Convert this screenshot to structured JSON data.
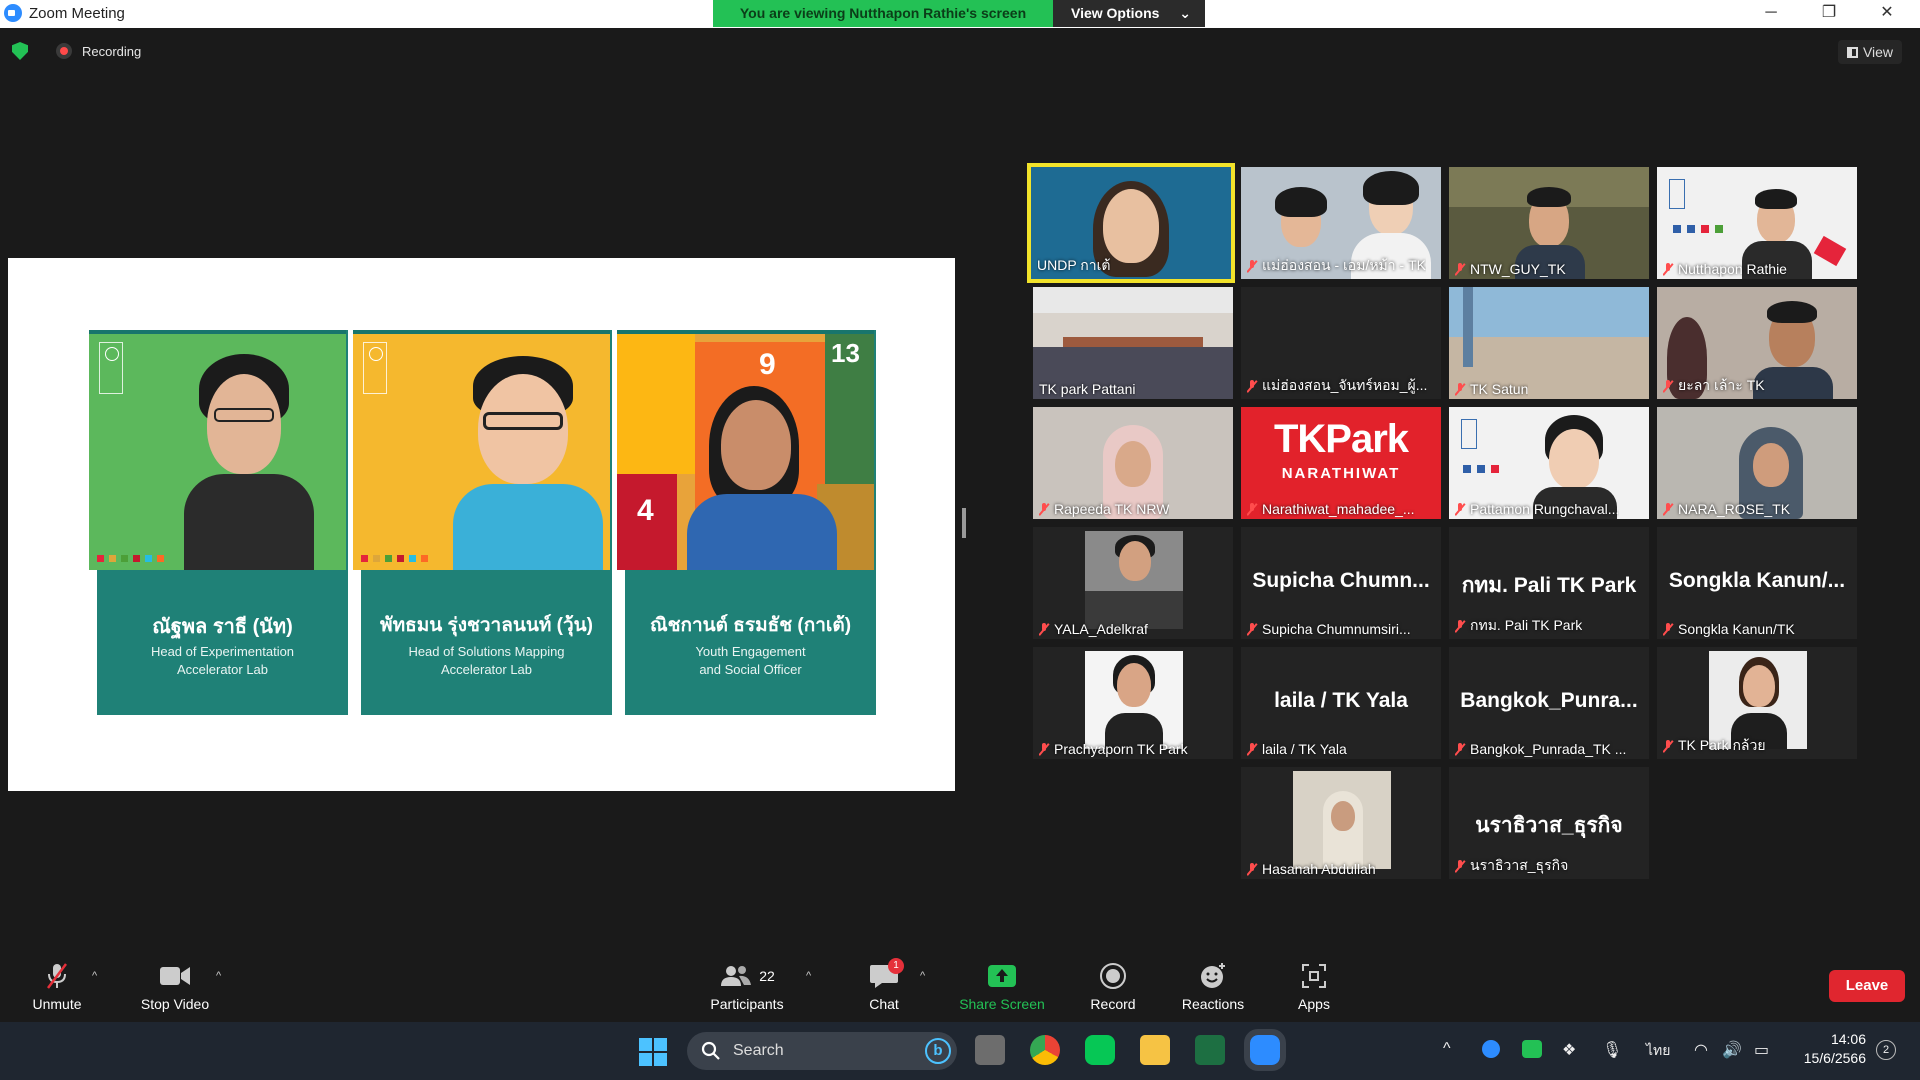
{
  "window": {
    "title": "Zoom Meeting"
  },
  "banner": {
    "message": "You are viewing Nutthapon Rathie's screen",
    "view_options": "View Options"
  },
  "status": {
    "recording": "Recording"
  },
  "view_button": "View",
  "slide": {
    "people": [
      {
        "name": "ณัฐพล ราธี (นัท)",
        "role_line1": "Head of Experimentation",
        "role_line2": "Accelerator Lab"
      },
      {
        "name": "พัทธมน รุ่งชวาลนนท์ (วุ้น)",
        "role_line1": "Head of Solutions Mapping",
        "role_line2": "Accelerator Lab"
      },
      {
        "name": "ณิชกานต์ ธรมธัช (กาเต้)",
        "role_line1": "Youth Engagement",
        "role_line2": "and Social Officer"
      }
    ],
    "sdg_texts": [
      "9",
      "13",
      "4"
    ]
  },
  "participants": [
    {
      "label": "UNDP กาเต้",
      "muted": false,
      "big": ""
    },
    {
      "label": "แม่ฮ่องสอน - เอม/หม้า - TK",
      "muted": true,
      "big": ""
    },
    {
      "label": "NTW_GUY_TK",
      "muted": true,
      "big": ""
    },
    {
      "label": "Nutthapon Rathie",
      "muted": true,
      "big": ""
    },
    {
      "label": "TK park Pattani",
      "muted": false,
      "big": ""
    },
    {
      "label": "แม่ฮ่องสอน_จันทร์หอม_ผู้...",
      "muted": true,
      "big": ""
    },
    {
      "label": "TK Satun",
      "muted": true,
      "big": ""
    },
    {
      "label": "ยะลา เล้าะ TK",
      "muted": true,
      "big": ""
    },
    {
      "label": "Rapeeda TK NRW",
      "muted": true,
      "big": ""
    },
    {
      "label": "Narathiwat_mahadee_...",
      "muted": true,
      "big": ""
    },
    {
      "label": "Pattamon Rungchaval...",
      "muted": true,
      "big": ""
    },
    {
      "label": "NARA_ROSE_TK",
      "muted": true,
      "big": ""
    },
    {
      "label": "YALA_Adelkraf",
      "muted": true,
      "big": ""
    },
    {
      "label": "Supicha Chumnumsiri...",
      "muted": true,
      "big": "Supicha Chumn..."
    },
    {
      "label": "กทม. Pali TK Park",
      "muted": true,
      "big": "กทม. Pali TK Park"
    },
    {
      "label": "Songkla Kanun/TK",
      "muted": true,
      "big": "Songkla Kanun/..."
    },
    {
      "label": "Prachyaporn TK Park",
      "muted": true,
      "big": ""
    },
    {
      "label": "laila / TK Yala",
      "muted": true,
      "big": "laila / TK Yala"
    },
    {
      "label": "Bangkok_Punrada_TK ...",
      "muted": true,
      "big": "Bangkok_Punra..."
    },
    {
      "label": "TK Park กล้วย",
      "muted": true,
      "big": ""
    },
    {
      "label": "Hasanah Abdullah",
      "muted": true,
      "big": ""
    },
    {
      "label": "นราธิวาส_ธุรกิจ",
      "muted": true,
      "big": "นราธิวาส_ธุรกิจ"
    }
  ],
  "tkpark_logo": {
    "line1": "TKPark",
    "line2": "NARATHIWAT"
  },
  "toolbar": {
    "unmute": "Unmute",
    "stop_video": "Stop Video",
    "participants": "Participants",
    "participants_count": "22",
    "chat": "Chat",
    "chat_badge": "1",
    "share_screen": "Share Screen",
    "record": "Record",
    "reactions": "Reactions",
    "apps": "Apps",
    "leave": "Leave"
  },
  "taskbar": {
    "search": "Search",
    "ime": "ไทย",
    "time": "14:06",
    "date": "15/6/2566",
    "notifications": "2"
  },
  "colors": {
    "accent_green": "#23C155",
    "leave_red": "#E0262F",
    "active_border": "#F2E32A",
    "slide_teal": "#1F8177"
  }
}
